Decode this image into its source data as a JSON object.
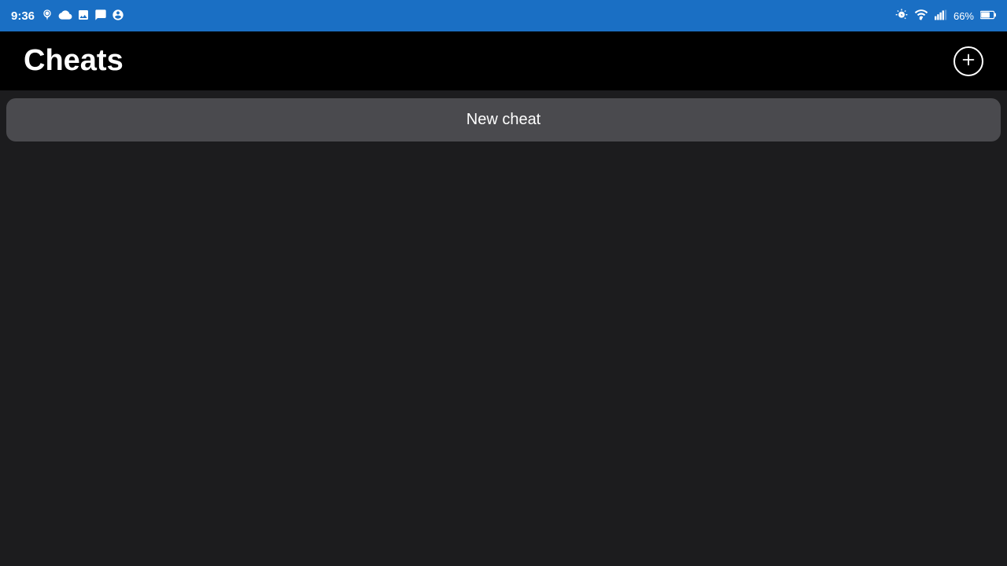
{
  "statusBar": {
    "time": "9:36",
    "batteryPercent": "66%",
    "icons": {
      "alarm": "⏰",
      "sync": "☁",
      "gallery": "🖼",
      "nfc": "📡",
      "face": "😊"
    }
  },
  "header": {
    "title": "Cheats",
    "addButtonLabel": "+"
  },
  "content": {
    "newCheatLabel": "New cheat"
  }
}
